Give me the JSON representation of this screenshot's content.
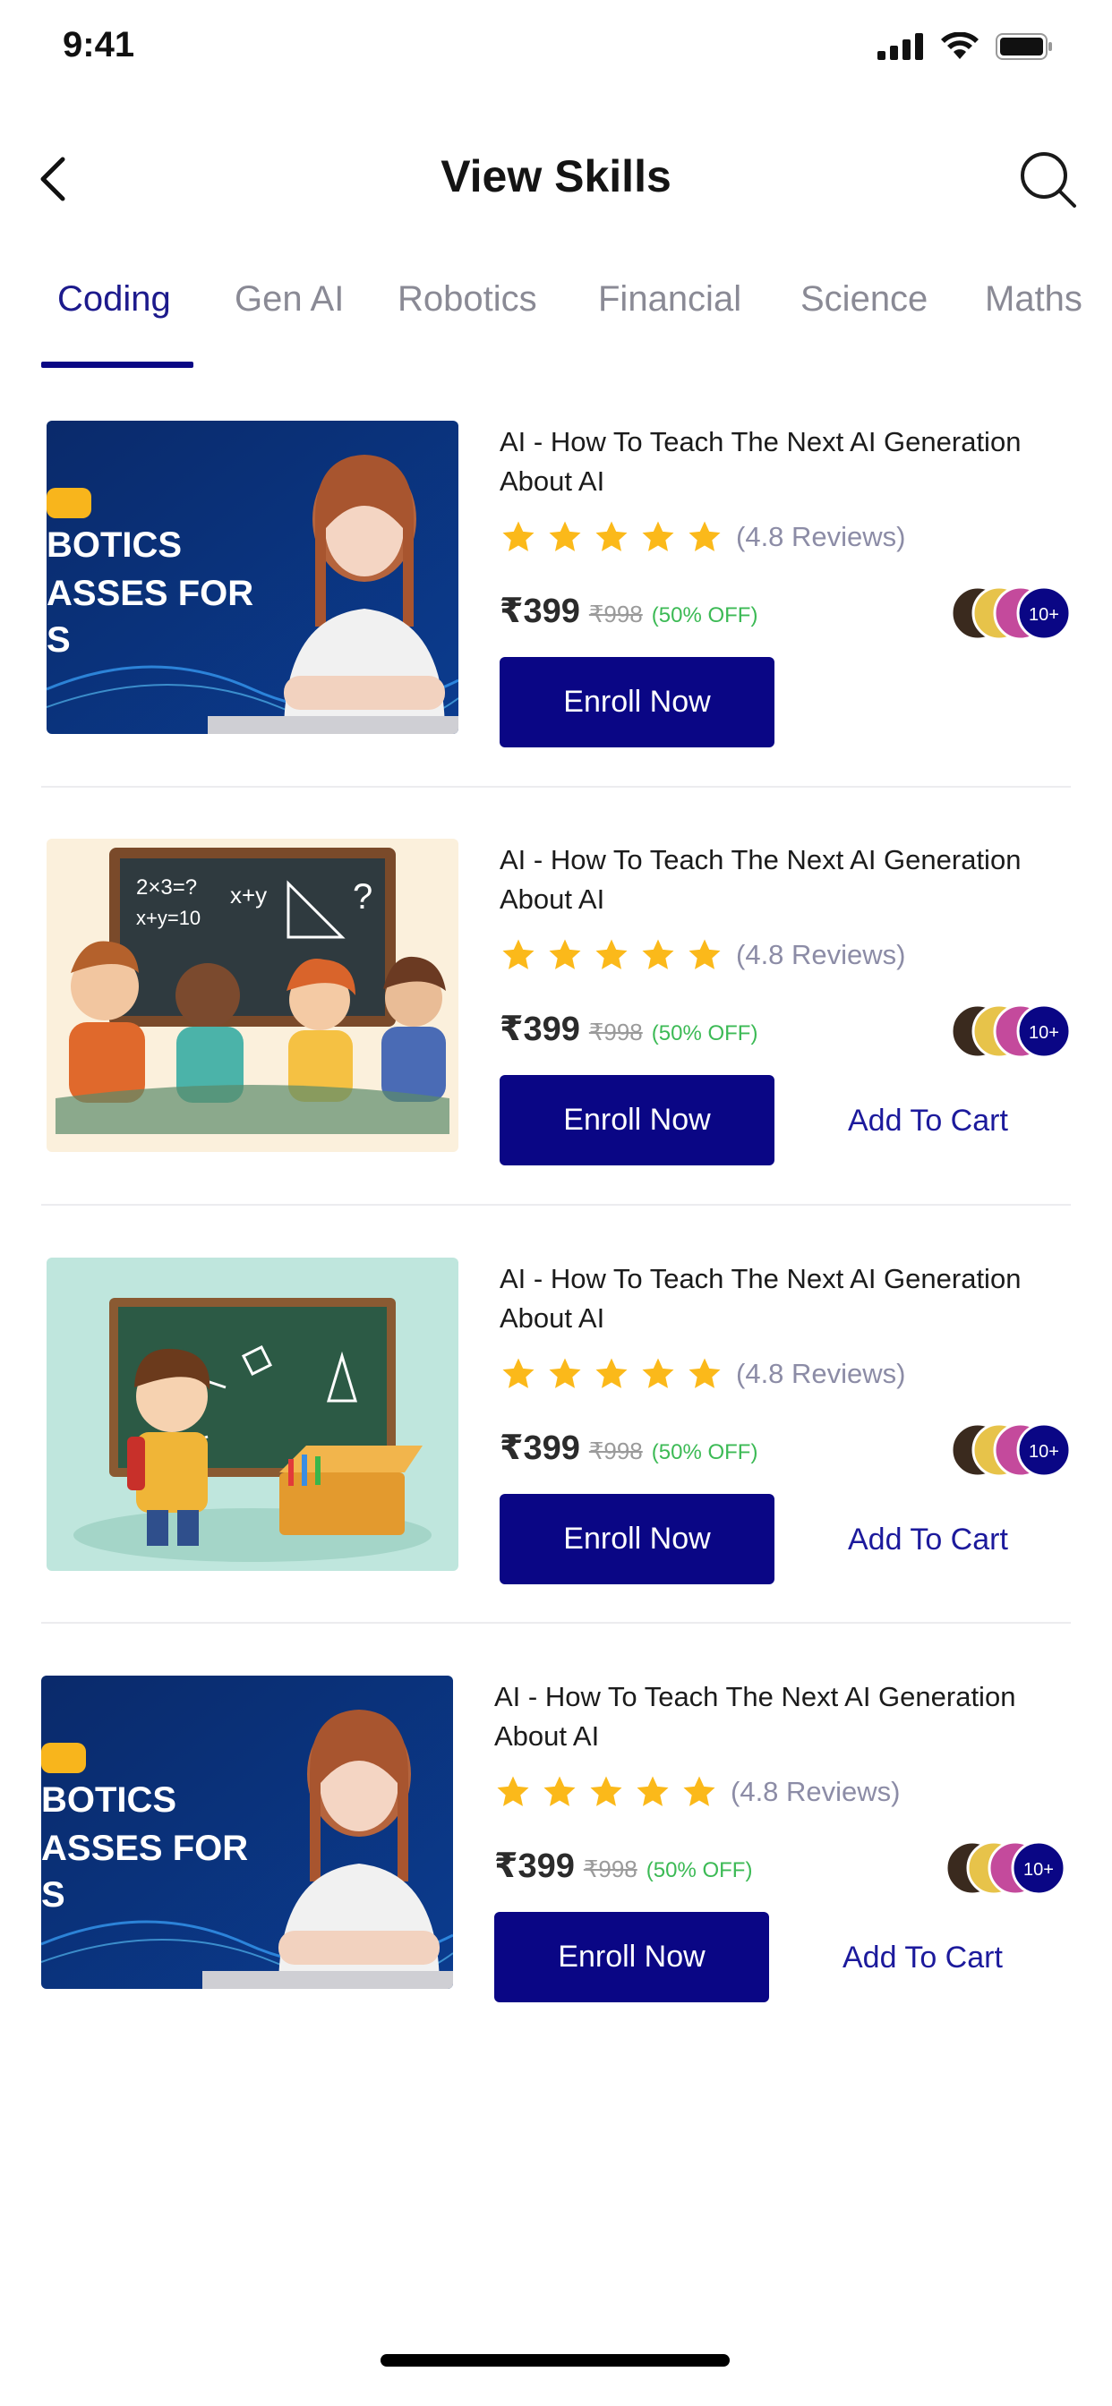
{
  "status_bar": {
    "time": "9:41"
  },
  "header": {
    "title": "View Skills"
  },
  "tabs": [
    {
      "label": "Coding",
      "active": true
    },
    {
      "label": "Gen AI",
      "active": false
    },
    {
      "label": "Robotics",
      "active": false
    },
    {
      "label": "Financial",
      "active": false
    },
    {
      "label": "Science",
      "active": false
    },
    {
      "label": "Maths",
      "active": false
    }
  ],
  "courses": [
    {
      "title": "AI - How To Teach The Next AI Generation About AI",
      "rating": 4.8,
      "rating_stars": 5,
      "reviews": "(4.8 Reviews)",
      "price": "₹399",
      "old_price": "₹998",
      "discount": "(50% OFF)",
      "enrolled_badge": "10+",
      "enroll_label": "Enroll Now",
      "cart_label": "",
      "thumbnail_text": [
        "BOTICS",
        "ASSES FOR",
        "S"
      ]
    },
    {
      "title": "AI - How To Teach The Next AI Generation About AI",
      "rating": 4.8,
      "rating_stars": 5,
      "reviews": "(4.8 Reviews)",
      "price": "₹399",
      "old_price": "₹998",
      "discount": "(50% OFF)",
      "enrolled_badge": "10+",
      "enroll_label": "Enroll Now",
      "cart_label": "Add To Cart",
      "thumbnail_text": [
        "2×3=?",
        "x+y=10",
        "x+y"
      ]
    },
    {
      "title": "AI - How To Teach The Next AI Generation About AI",
      "rating": 4.8,
      "rating_stars": 5,
      "reviews": "(4.8 Reviews)",
      "price": "₹399",
      "old_price": "₹998",
      "discount": "(50% OFF)",
      "enrolled_badge": "10+",
      "enroll_label": "Enroll Now",
      "cart_label": "Add To Cart",
      "thumbnail_text": []
    },
    {
      "title": "AI - How To Teach The Next AI Generation About AI",
      "rating": 4.8,
      "rating_stars": 5,
      "reviews": "(4.8 Reviews)",
      "price": "₹399",
      "old_price": "₹998",
      "discount": "(50% OFF)",
      "enrolled_badge": "10+",
      "enroll_label": "Enroll Now",
      "cart_label": "Add To Cart",
      "thumbnail_text": [
        "BOTICS",
        "ASSES FOR",
        "S"
      ]
    }
  ],
  "colors": {
    "primary": "#0a0685",
    "tab_active": "#1c1a8c",
    "tab_inactive": "#8a8a95",
    "star": "#fbb91a",
    "discount": "#3cba55"
  },
  "icons": {
    "back": "chevron-left-icon",
    "search": "search-icon",
    "signal": "signal-icon",
    "wifi": "wifi-icon",
    "battery": "battery-icon",
    "star": "star-icon"
  }
}
